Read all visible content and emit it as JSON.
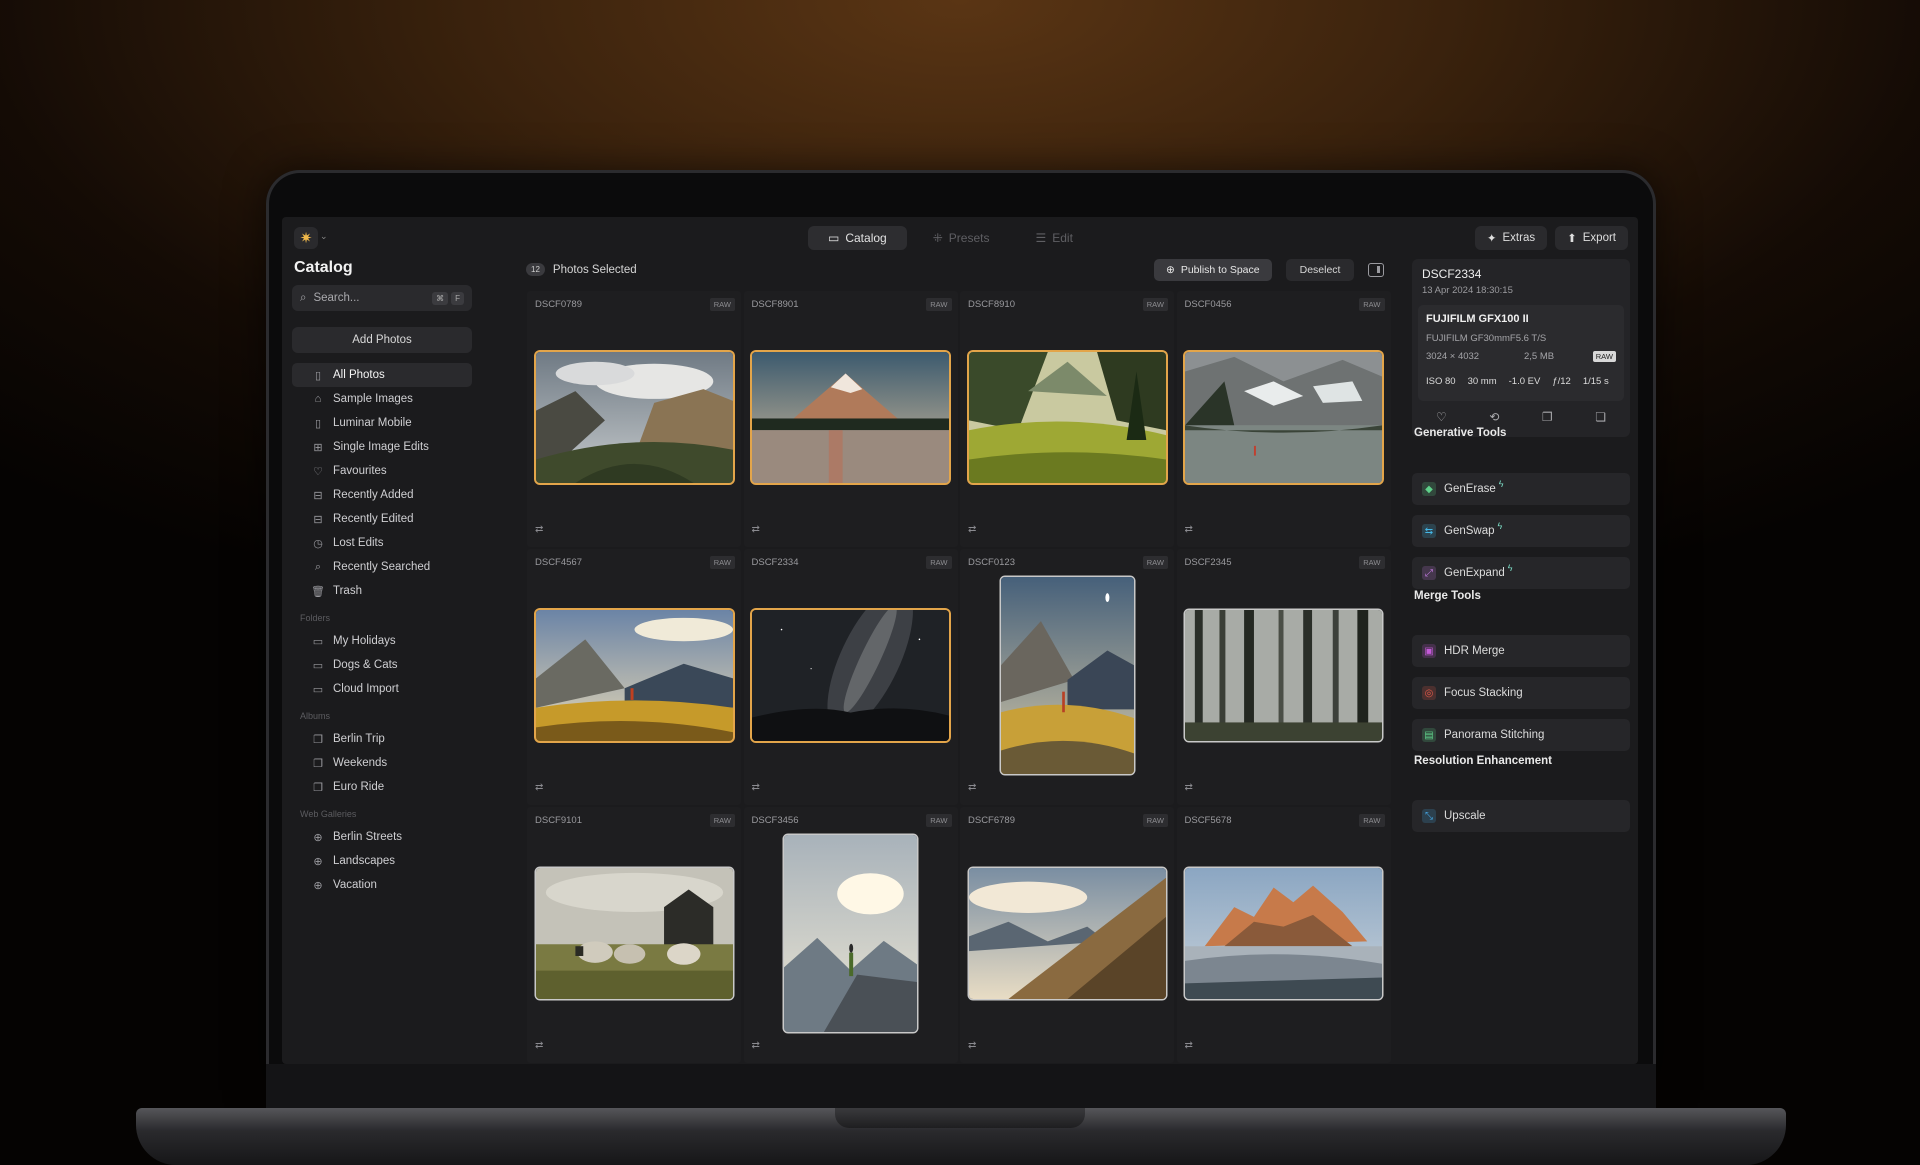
{
  "toolbar": {
    "logo_glyph": "✷",
    "tabs": [
      {
        "label": "Catalog",
        "icon": "folder-icon",
        "active": true
      },
      {
        "label": "Presets",
        "icon": "presets-icon",
        "active": false
      },
      {
        "label": "Edit",
        "icon": "sliders-icon",
        "active": false
      }
    ],
    "extras_label": "Extras",
    "export_label": "Export"
  },
  "sidebar": {
    "title": "Catalog",
    "search_placeholder": "Search...",
    "search_keys": [
      "⌘",
      "F"
    ],
    "add_photos_label": "Add Photos",
    "library": [
      {
        "label": "All Photos",
        "icon": "photos-icon",
        "glyph": "▯",
        "active": true
      },
      {
        "label": "Sample Images",
        "icon": "graduation-cap-icon",
        "glyph": "⌂"
      },
      {
        "label": "Luminar Mobile",
        "icon": "phone-icon",
        "glyph": "▯"
      },
      {
        "label": "Single Image Edits",
        "icon": "grid-icon",
        "glyph": "⊞"
      },
      {
        "label": "Favourites",
        "icon": "heart-icon",
        "glyph": "♡"
      },
      {
        "label": "Recently Added",
        "icon": "recent-added-icon",
        "glyph": "⊟"
      },
      {
        "label": "Recently Edited",
        "icon": "recent-edited-icon",
        "glyph": "⊟"
      },
      {
        "label": "Lost Edits",
        "icon": "lost-edits-icon",
        "glyph": "◷"
      },
      {
        "label": "Recently Searched",
        "icon": "search-icon",
        "glyph": "⌕"
      },
      {
        "label": "Trash",
        "icon": "trash-icon",
        "glyph": "🗑"
      }
    ],
    "folders_title": "Folders",
    "folders": [
      {
        "label": "My Holidays",
        "icon": "folder-icon",
        "glyph": "▭"
      },
      {
        "label": "Dogs & Cats",
        "icon": "folder-icon",
        "glyph": "▭"
      },
      {
        "label": "Cloud Import",
        "icon": "folder-icon",
        "glyph": "▭"
      }
    ],
    "albums_title": "Albums",
    "albums": [
      {
        "label": "Berlin Trip",
        "icon": "album-icon",
        "glyph": "❐"
      },
      {
        "label": "Weekends",
        "icon": "album-icon",
        "glyph": "❐"
      },
      {
        "label": "Euro Ride",
        "icon": "album-icon",
        "glyph": "❐"
      }
    ],
    "web_title": "Web Galleries",
    "web": [
      {
        "label": "Berlin Streets",
        "icon": "globe-icon",
        "glyph": "⊕"
      },
      {
        "label": "Landscapes",
        "icon": "globe-icon",
        "glyph": "⊕"
      },
      {
        "label": "Vacation",
        "icon": "globe-icon",
        "glyph": "⊕"
      }
    ]
  },
  "grid": {
    "selected_count": "12",
    "selected_label": "Photos Selected",
    "publish_label": "Publish to Space",
    "deselect_label": "Deselect",
    "raw_label": "RAW",
    "adjust_glyph": "⇄",
    "photos": [
      {
        "name": "DSCF0789",
        "scene": "valley",
        "orientation": "landscape",
        "selected": true
      },
      {
        "name": "DSCF8901",
        "scene": "mountain-lake",
        "orientation": "landscape",
        "selected": true
      },
      {
        "name": "DSCF8910",
        "scene": "meadow",
        "orientation": "landscape",
        "selected": true
      },
      {
        "name": "DSCF0456",
        "scene": "alpine-lake",
        "orientation": "landscape",
        "selected": true
      },
      {
        "name": "DSCF4567",
        "scene": "hiker-ridge",
        "orientation": "landscape",
        "selected": true
      },
      {
        "name": "DSCF2334",
        "scene": "milky-way",
        "orientation": "landscape",
        "selected": true
      },
      {
        "name": "DSCF0123",
        "scene": "hiker-portrait",
        "orientation": "portrait",
        "selected": false
      },
      {
        "name": "DSCF2345",
        "scene": "forest",
        "orientation": "landscape",
        "selected": false
      },
      {
        "name": "DSCF9101",
        "scene": "sheep",
        "orientation": "landscape",
        "selected": false
      },
      {
        "name": "DSCF3456",
        "scene": "summit-hiker",
        "orientation": "portrait",
        "selected": false
      },
      {
        "name": "DSCF6789",
        "scene": "slope",
        "orientation": "landscape",
        "selected": false
      },
      {
        "name": "DSCF5678",
        "scene": "castle-peak",
        "orientation": "landscape",
        "selected": false
      }
    ]
  },
  "info": {
    "filename": "DSCF2334",
    "datetime": "13 Apr 2024 18:30:15",
    "camera": "FUJIFILM GFX100 II",
    "lens": "FUJIFILM GF30mmF5.6 T/S",
    "dimensions": "3024 × 4032",
    "filesize": "2,5 MB",
    "format": "RAW",
    "iso": "ISO 80",
    "focal": "30 mm",
    "ev": "-1.0 EV",
    "aperture": "ƒ/12",
    "shutter": "1/15 s"
  },
  "tools": {
    "generative_title": "Generative Tools",
    "generative": [
      {
        "label": "GenErase",
        "icon": "generase-icon",
        "color": "#5fd08a",
        "glyph": "◆"
      },
      {
        "label": "GenSwap",
        "icon": "genswap-icon",
        "color": "#45b8e8",
        "glyph": "⇆"
      },
      {
        "label": "GenExpand",
        "icon": "genexpand-icon",
        "color": "#c27be0",
        "glyph": "⤢"
      }
    ],
    "spark_glyph": "ϟ",
    "merge_title": "Merge Tools",
    "merge": [
      {
        "label": "HDR Merge",
        "icon": "hdr-merge-icon",
        "color": "#c45ad8",
        "glyph": "▣"
      },
      {
        "label": "Focus Stacking",
        "icon": "focus-stacking-icon",
        "color": "#e25a4a",
        "glyph": "◎"
      },
      {
        "label": "Panorama Stitching",
        "icon": "panorama-icon",
        "color": "#5fd08a",
        "glyph": "▤"
      }
    ],
    "resolution_title": "Resolution Enhancement",
    "resolution": [
      {
        "label": "Upscale",
        "icon": "upscale-icon",
        "color": "#45a8e8",
        "glyph": "⤡"
      }
    ]
  }
}
